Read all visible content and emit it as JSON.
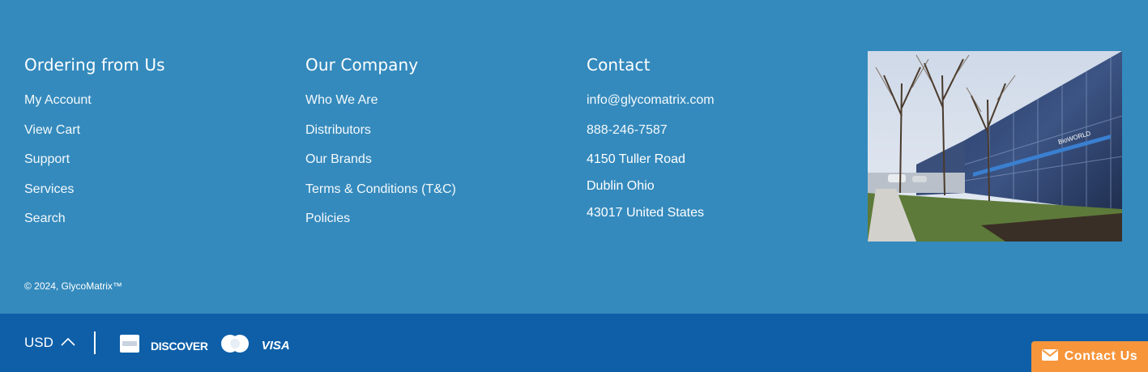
{
  "footer": {
    "ordering": {
      "heading": "Ordering from Us",
      "links": [
        "My Account",
        "View Cart",
        "Support",
        "Services",
        "Search"
      ]
    },
    "company": {
      "heading": "Our Company",
      "links": [
        "Who We Are",
        "Distributors",
        "Our Brands",
        "Terms & Conditions (T&C)",
        "Policies"
      ]
    },
    "contact": {
      "heading": "Contact",
      "email": "info@glycomatrix.com",
      "phone": "888-246-7587",
      "address_line1": "4150 Tuller Road",
      "address_line2": "Dublin Ohio",
      "address_line3": "43017 United States"
    },
    "photo": {
      "building_sign": "BioWORLD"
    },
    "copyright": "© 2024, GlycoMatrix™"
  },
  "bottom_bar": {
    "currency": "USD",
    "payment_icons": [
      "american-express-icon",
      "discover-icon",
      "diners-club-icon",
      "visa-icon"
    ],
    "payment_labels": {
      "discover": "DISCOVER",
      "visa": "VISA"
    }
  },
  "contact_tab": {
    "label": "Contact Us"
  },
  "colors": {
    "footer_bg": "#348abd",
    "bottom_bar_bg": "#0e5fa8",
    "contact_tab_bg": "#f7953b",
    "text": "#ffffff"
  }
}
